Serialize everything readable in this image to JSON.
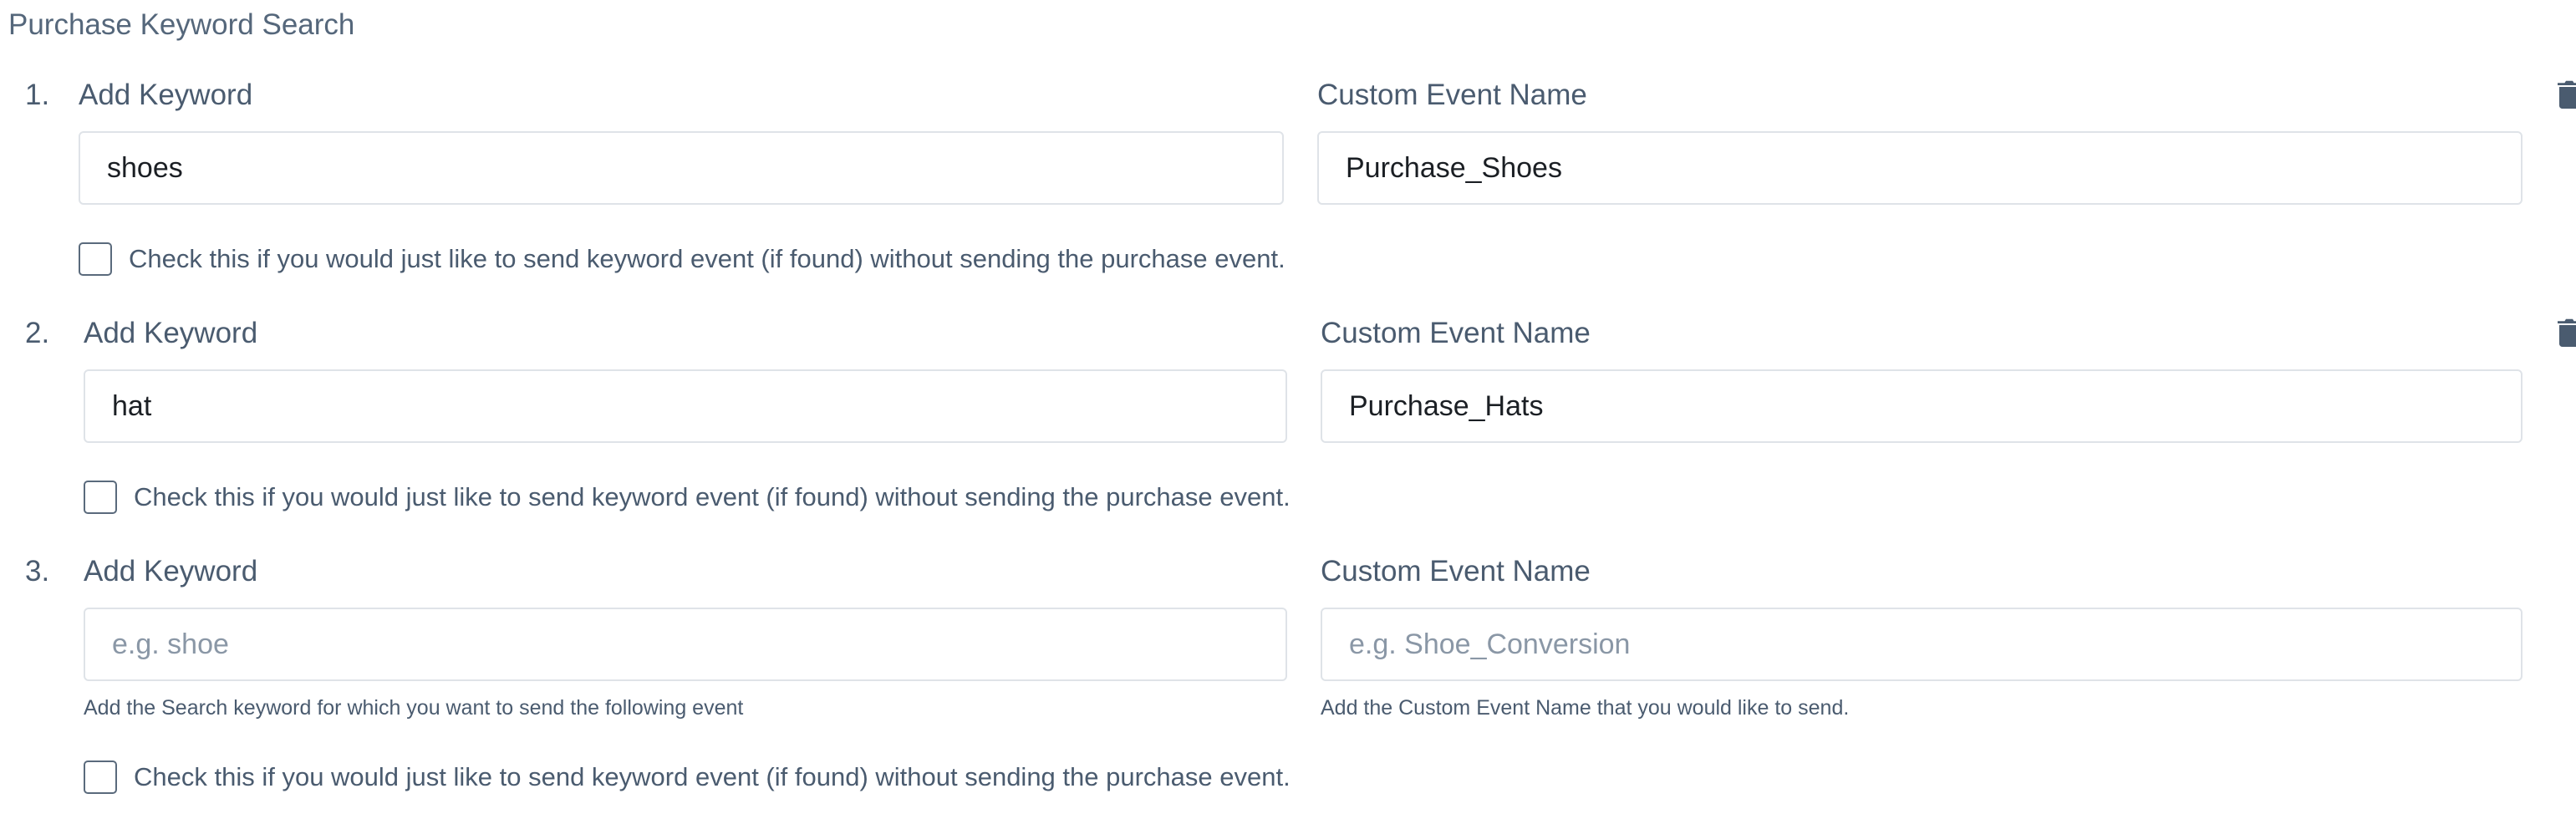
{
  "section": {
    "title": "Purchase Keyword Search"
  },
  "colors": {
    "text": "#4a5b6f",
    "border": "#dfe3e8",
    "placeholder": "#8a97a6",
    "icon": "#4a5b6f"
  },
  "rows": [
    {
      "number": "1.",
      "keyword_label": "Add Keyword",
      "keyword_value": "shoes",
      "keyword_placeholder": "",
      "event_label": "Custom Event Name",
      "event_value": "Purchase_Shoes",
      "event_placeholder": "",
      "checkbox_label": "Check this if you would just like to send keyword event (if found) without sending the purchase event.",
      "checked": false,
      "has_delete": true,
      "delete_icon": "trash-icon"
    },
    {
      "number": "2.",
      "keyword_label": "Add Keyword",
      "keyword_value": "hat",
      "keyword_placeholder": "",
      "event_label": "Custom Event Name",
      "event_value": "Purchase_Hats",
      "event_placeholder": "",
      "checkbox_label": "Check this if you would just like to send keyword event (if found) without sending the purchase event.",
      "checked": false,
      "has_delete": true,
      "delete_icon": "trash-icon"
    },
    {
      "number": "3.",
      "keyword_label": "Add Keyword",
      "keyword_value": "",
      "keyword_placeholder": "e.g. shoe",
      "keyword_help": "Add the Search keyword for which you want to send the following event",
      "event_label": "Custom Event Name",
      "event_value": "",
      "event_placeholder": "e.g. Shoe_Conversion",
      "event_help": "Add the Custom Event Name that you would like to send.",
      "checkbox_label": "Check this if you would just like to send keyword event (if found) without sending the purchase event.",
      "checked": false,
      "has_delete": false
    }
  ]
}
